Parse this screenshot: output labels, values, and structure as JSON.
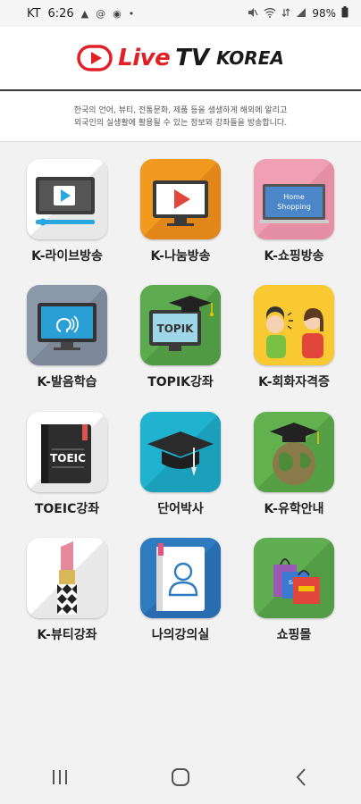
{
  "status_bar": {
    "carrier": "KT",
    "time": "6:26",
    "battery": "98%",
    "notif_icons": [
      "image-icon",
      "at-icon",
      "chat-icon",
      "dot-icon"
    ],
    "system_icons": [
      "mute-icon",
      "wifi-icon",
      "data-icon",
      "signal-icon",
      "battery-icon"
    ]
  },
  "header": {
    "logo_live": "Live",
    "logo_tv": "TV",
    "logo_korea": "KOREA"
  },
  "description": {
    "line1": "한국의 언어, 뷰티, 전통문화, 제품 등을 생생하게 해외에 알리고",
    "line2": "외국인의 실생활에 활용될 수 있는 정보와 강좌들을 방송합니다."
  },
  "menu": [
    {
      "label": "K-라이브방송",
      "icon": "live-tv-icon",
      "color": "#ffffff"
    },
    {
      "label": "K-나눔방송",
      "icon": "share-tv-icon",
      "color": "#f29a1f"
    },
    {
      "label": "K-쇼핑방송",
      "icon": "shopping-tv-icon",
      "color": "#f0a0b4"
    },
    {
      "label": "K-발음학습",
      "icon": "pronunciation-icon",
      "color": "#8c99a8"
    },
    {
      "label": "TOPIK강좌",
      "icon": "topik-icon",
      "color": "#5cab4e"
    },
    {
      "label": "K-회화자격증",
      "icon": "conversation-icon",
      "color": "#f9c931"
    },
    {
      "label": "TOEIC강좌",
      "icon": "toeic-book-icon",
      "color": "#ffffff"
    },
    {
      "label": "단어박사",
      "icon": "graduation-cap-icon",
      "color": "#1fb3d0"
    },
    {
      "label": "K-유학안내",
      "icon": "globe-cap-icon",
      "color": "#62b14f"
    },
    {
      "label": "K-뷰티강좌",
      "icon": "lipstick-icon",
      "color": "#ffffff"
    },
    {
      "label": "나의강의실",
      "icon": "profile-icon",
      "color": "#2e7bbf"
    },
    {
      "label": "쇼핑몰",
      "icon": "shopping-bag-icon",
      "color": "#5fae52"
    }
  ],
  "icon_text": {
    "home_shopping": "Home\nShopping",
    "topik": "TOPIK",
    "toeic": "TOEIC",
    "sale": "sale"
  },
  "nav": [
    "recent-apps-icon",
    "home-icon",
    "back-icon"
  ]
}
